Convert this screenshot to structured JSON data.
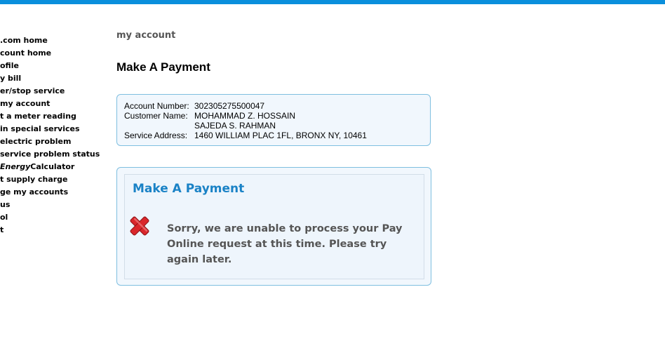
{
  "sidebar": {
    "items": [
      {
        "label": ".com home"
      },
      {
        "label": "count home"
      },
      {
        "label": "ofile"
      },
      {
        "label": "y bill"
      },
      {
        "label": "er/stop service"
      },
      {
        "label": "my account"
      },
      {
        "label": "t a meter reading"
      },
      {
        "label": "in special services"
      },
      {
        "label": " electric problem"
      },
      {
        "label": " service problem status"
      },
      {
        "label_em": "Energy",
        "label": "Calculator"
      },
      {
        "label": "t supply charge"
      },
      {
        "label": "ge my accounts"
      },
      {
        "label": " us"
      },
      {
        "label": "ol"
      },
      {
        "label": "t"
      }
    ]
  },
  "breadcrumb": "my account",
  "page_title": "Make A Payment",
  "account": {
    "number_label": "Account Number:",
    "number": "302305275500047",
    "customer_label": "Customer Name:",
    "customer_1": "MOHAMMAD Z. HOSSAIN",
    "customer_2": "SAJEDA S. RAHMAN",
    "address_label": "Service Address:",
    "address": "1460 WILLIAM PLAC 1FL, BRONX NY, 10461"
  },
  "payment": {
    "heading": "Make A Payment",
    "error_icon": "red-x-icon",
    "message": "Sorry, we are unable to process your Pay Online request at this time. Please try again later."
  },
  "colors": {
    "top_bar": "#0a8fdc",
    "heading_blue": "#1a82c6",
    "box_border": "#7fbfe0",
    "box_bg": "#f1f7fd",
    "error_red": "#d9262b"
  }
}
